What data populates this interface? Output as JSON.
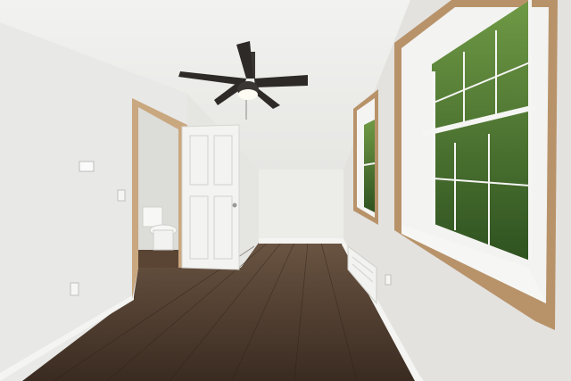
{
  "scene": {
    "description_free": true,
    "colors": {
      "ceiling": "#efefed",
      "wall_left": "#e8e8e6",
      "wall_back": "#ecece9",
      "wall_right": "#e4e3e0",
      "floor_dark": "#3e2f24",
      "floor_light": "#6a5442",
      "trim": "#f4f4f2",
      "window_frame": "#b8936a",
      "foliage": "#3f6b2a",
      "door": "#f3f3f1"
    },
    "icons": {
      "ceiling_fan": "ceiling-fan-icon",
      "thermostat": "thermostat-icon",
      "outlet": "outlet-icon",
      "radiator": "baseboard-heater-icon",
      "toilet": "toilet-icon"
    }
  }
}
